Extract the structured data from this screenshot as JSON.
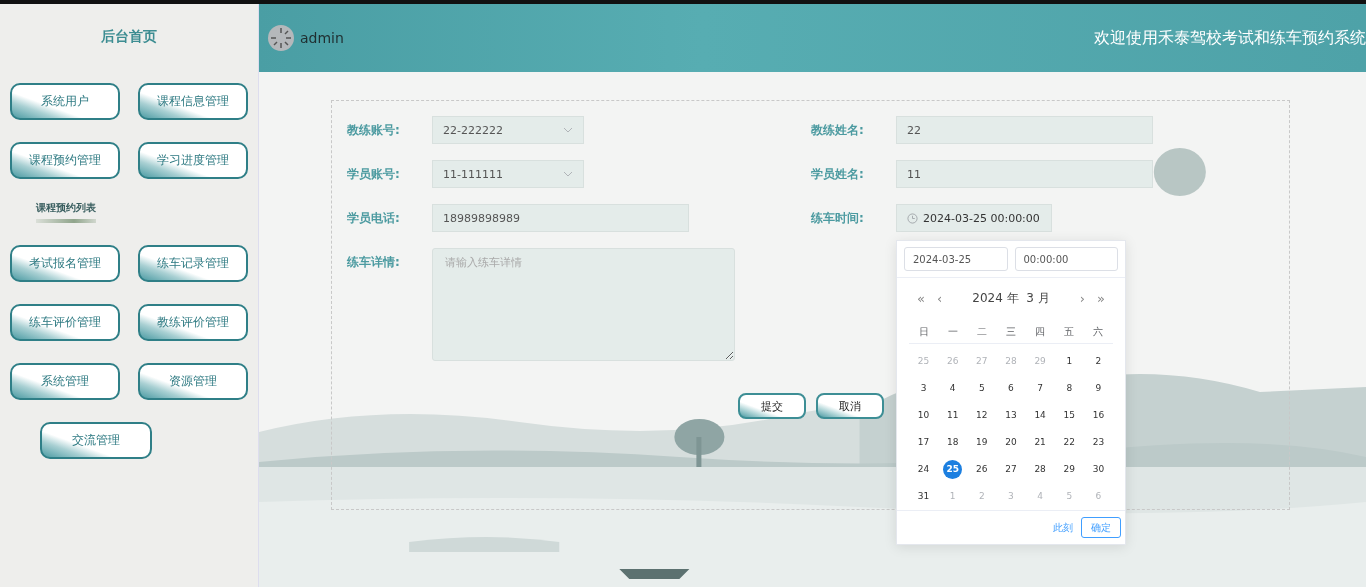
{
  "sidebar": {
    "title": "后台首页",
    "items": [
      {
        "kind": "button",
        "label": "系统用户"
      },
      {
        "kind": "button",
        "label": "课程信息管理"
      },
      {
        "kind": "button",
        "label": "课程预约管理"
      },
      {
        "kind": "button",
        "label": "学习进度管理"
      },
      {
        "kind": "section",
        "label": "课程预约列表"
      },
      {
        "kind": "button",
        "label": "考试报名管理"
      },
      {
        "kind": "button",
        "label": "练车记录管理"
      },
      {
        "kind": "button",
        "label": "练车评价管理"
      },
      {
        "kind": "button",
        "label": "教练评价管理"
      },
      {
        "kind": "button",
        "label": "系统管理"
      },
      {
        "kind": "button",
        "label": "资源管理"
      },
      {
        "kind": "button",
        "label": "交流管理"
      }
    ]
  },
  "header": {
    "user": "admin",
    "title": "欢迎使用禾泰驾校考试和练车预约系统"
  },
  "form": {
    "rows": [
      [
        {
          "label": "教练账号:",
          "kind": "select",
          "value": "22-222222"
        },
        {
          "label": "教练姓名:",
          "kind": "input",
          "value": "22"
        }
      ],
      [
        {
          "label": "学员账号:",
          "kind": "select",
          "value": "11-111111"
        },
        {
          "label": "学员姓名:",
          "kind": "input",
          "value": "11"
        }
      ],
      [
        {
          "label": "学员电话:",
          "kind": "input",
          "value": "18989898989"
        },
        {
          "label": "练车时间:",
          "kind": "datetime",
          "value": "2024-03-25 00:00:00"
        }
      ],
      [
        {
          "label": "练车详情:",
          "kind": "textarea",
          "placeholder": "请输入练车详情"
        }
      ]
    ],
    "buttons": [
      "提交",
      "取消"
    ]
  },
  "date_picker": {
    "date": "2024-03-25",
    "time": "00:00:00",
    "nav": [
      "«",
      "‹",
      "›",
      "»"
    ],
    "month_label": "2024 年  3 月",
    "weekdays": [
      "日",
      "一",
      "二",
      "三",
      "四",
      "五",
      "六"
    ],
    "days": [
      {
        "label": "25",
        "other_month": true,
        "selected": false
      },
      {
        "label": "26",
        "other_month": true,
        "selected": false
      },
      {
        "label": "27",
        "other_month": true,
        "selected": false
      },
      {
        "label": "28",
        "other_month": true,
        "selected": false
      },
      {
        "label": "29",
        "other_month": true,
        "selected": false
      },
      {
        "label": "1",
        "other_month": false,
        "selected": false
      },
      {
        "label": "2",
        "other_month": false,
        "selected": false
      },
      {
        "label": "3",
        "other_month": false,
        "selected": false
      },
      {
        "label": "4",
        "other_month": false,
        "selected": false
      },
      {
        "label": "5",
        "other_month": false,
        "selected": false
      },
      {
        "label": "6",
        "other_month": false,
        "selected": false
      },
      {
        "label": "7",
        "other_month": false,
        "selected": false
      },
      {
        "label": "8",
        "other_month": false,
        "selected": false
      },
      {
        "label": "9",
        "other_month": false,
        "selected": false
      },
      {
        "label": "10",
        "other_month": false,
        "selected": false
      },
      {
        "label": "11",
        "other_month": false,
        "selected": false
      },
      {
        "label": "12",
        "other_month": false,
        "selected": false
      },
      {
        "label": "13",
        "other_month": false,
        "selected": false
      },
      {
        "label": "14",
        "other_month": false,
        "selected": false
      },
      {
        "label": "15",
        "other_month": false,
        "selected": false
      },
      {
        "label": "16",
        "other_month": false,
        "selected": false
      },
      {
        "label": "17",
        "other_month": false,
        "selected": false
      },
      {
        "label": "18",
        "other_month": false,
        "selected": false
      },
      {
        "label": "19",
        "other_month": false,
        "selected": false
      },
      {
        "label": "20",
        "other_month": false,
        "selected": false
      },
      {
        "label": "21",
        "other_month": false,
        "selected": false
      },
      {
        "label": "22",
        "other_month": false,
        "selected": false
      },
      {
        "label": "23",
        "other_month": false,
        "selected": false
      },
      {
        "label": "24",
        "other_month": false,
        "selected": false
      },
      {
        "label": "25",
        "other_month": false,
        "selected": true
      },
      {
        "label": "26",
        "other_month": false,
        "selected": false
      },
      {
        "label": "27",
        "other_month": false,
        "selected": false
      },
      {
        "label": "28",
        "other_month": false,
        "selected": false
      },
      {
        "label": "29",
        "other_month": false,
        "selected": false
      },
      {
        "label": "30",
        "other_month": false,
        "selected": false
      },
      {
        "label": "31",
        "other_month": false,
        "selected": false
      },
      {
        "label": "1",
        "other_month": true,
        "selected": false
      },
      {
        "label": "2",
        "other_month": true,
        "selected": false
      },
      {
        "label": "3",
        "other_month": true,
        "selected": false
      },
      {
        "label": "4",
        "other_month": true,
        "selected": false
      },
      {
        "label": "5",
        "other_month": true,
        "selected": false
      },
      {
        "label": "6",
        "other_month": true,
        "selected": false
      }
    ],
    "now_link": "此刻",
    "confirm_button": "确定"
  }
}
